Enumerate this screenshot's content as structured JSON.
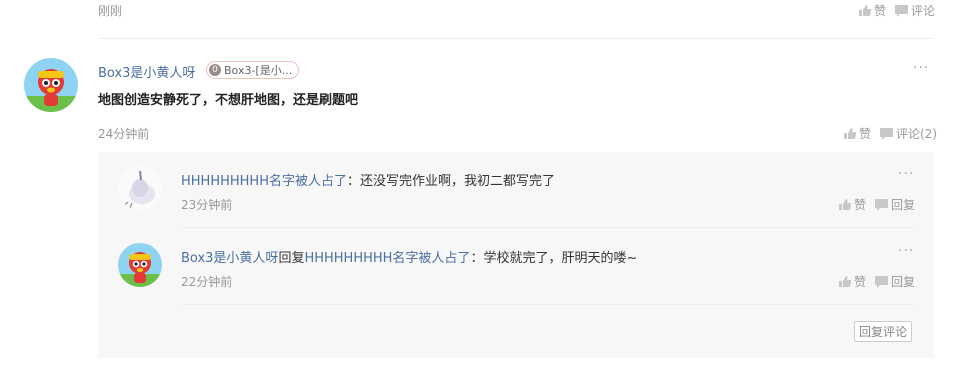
{
  "top": {
    "time": "刚刚",
    "like": "赞",
    "comment": "评论"
  },
  "main": {
    "user": "Box3是小黄人呀",
    "badge_num": "0",
    "badge_text": "Box3-[是小...",
    "text": "地图创造安静死了，不想肝地图，还是刷题吧",
    "time": "24分钟前",
    "like": "赞",
    "comment": "评论(2)",
    "more": "···"
  },
  "replies": [
    {
      "user": "HHHHHHHHH名字被人占了",
      "sep": "：",
      "text": "还没写完作业啊，我初二都写完了",
      "time": "23分钟前",
      "like": "赞",
      "reply": "回复",
      "more": "···"
    },
    {
      "user": "Box3是小黄人呀",
      "mid": "回复",
      "target": "HHHHHHHHH名字被人占了",
      "sep": "：",
      "text": "学校就完了，肝明天的喽~",
      "time": "22分钟前",
      "like": "赞",
      "reply": "回复",
      "more": "···"
    }
  ],
  "reply_button": "回复评论"
}
